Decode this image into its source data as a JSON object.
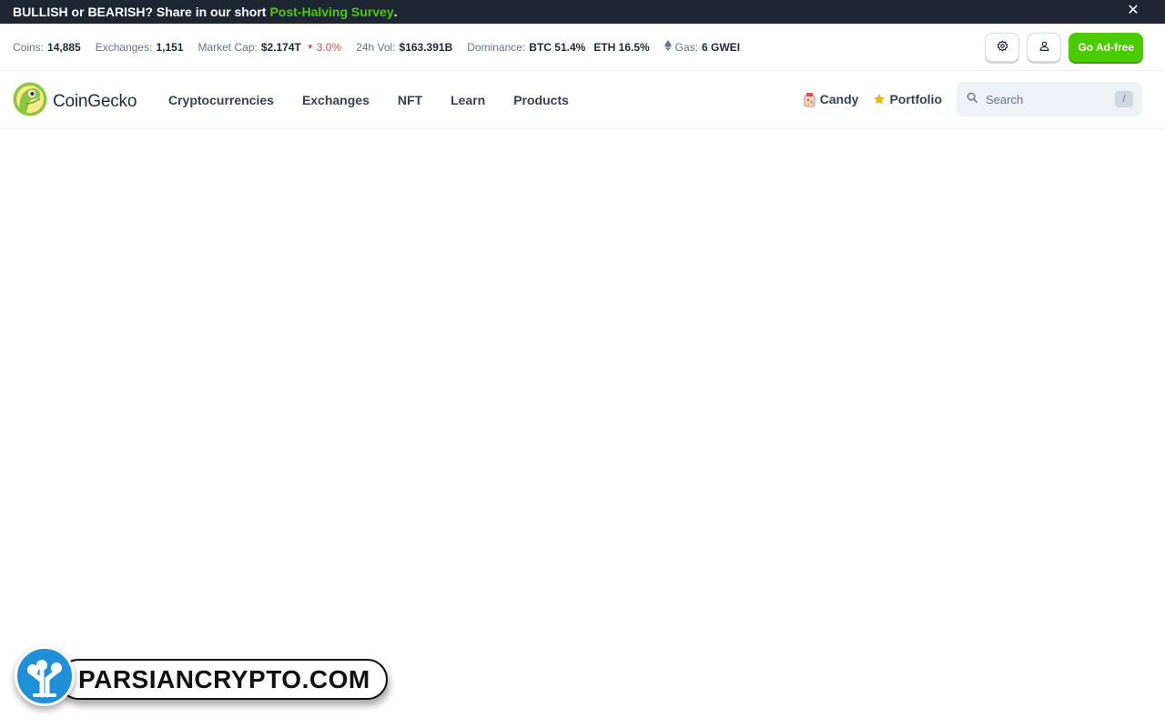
{
  "banner": {
    "text": "BULLISH or BEARISH? Share in our short",
    "link": "Post-Halving Survey",
    "suffix": ".",
    "close": "✕"
  },
  "stats": {
    "coins_label": "Coins:",
    "coins_value": "14,885",
    "exchanges_label": "Exchanges:",
    "exchanges_value": "1,151",
    "market_cap_label": "Market Cap:",
    "market_cap_value": "$2.174T",
    "market_cap_change": "3.0%",
    "vol_label": "24h Vol:",
    "vol_value": "$163.391B",
    "dominance_label": "Dominance:",
    "btc_dominance": "BTC 51.4%",
    "eth_dominance": "ETH 16.5%",
    "gas_label": "Gas:",
    "gas_value": "6 GWEI",
    "change_color": "#e5484d"
  },
  "actions": {
    "ad_free_label": "Go Ad-free",
    "accent_color": "#4bcc00"
  },
  "nav": {
    "logo_text": "CoinGecko",
    "menu": [
      "Cryptocurrencies",
      "Exchanges",
      "NFT",
      "Learn",
      "Products"
    ],
    "candy_label": "Candy",
    "portfolio_label": "Portfolio",
    "search_placeholder": "Search",
    "search_shortcut": "/"
  },
  "watermark": {
    "text": "PARSIANCRYPTO.COM"
  },
  "icons": {
    "settings": "gear-icon",
    "user": "user-icon",
    "search": "search-icon",
    "close": "close-icon",
    "candy": "candy-icon",
    "portfolio": "star-icon",
    "eth": "ethereum-icon"
  }
}
